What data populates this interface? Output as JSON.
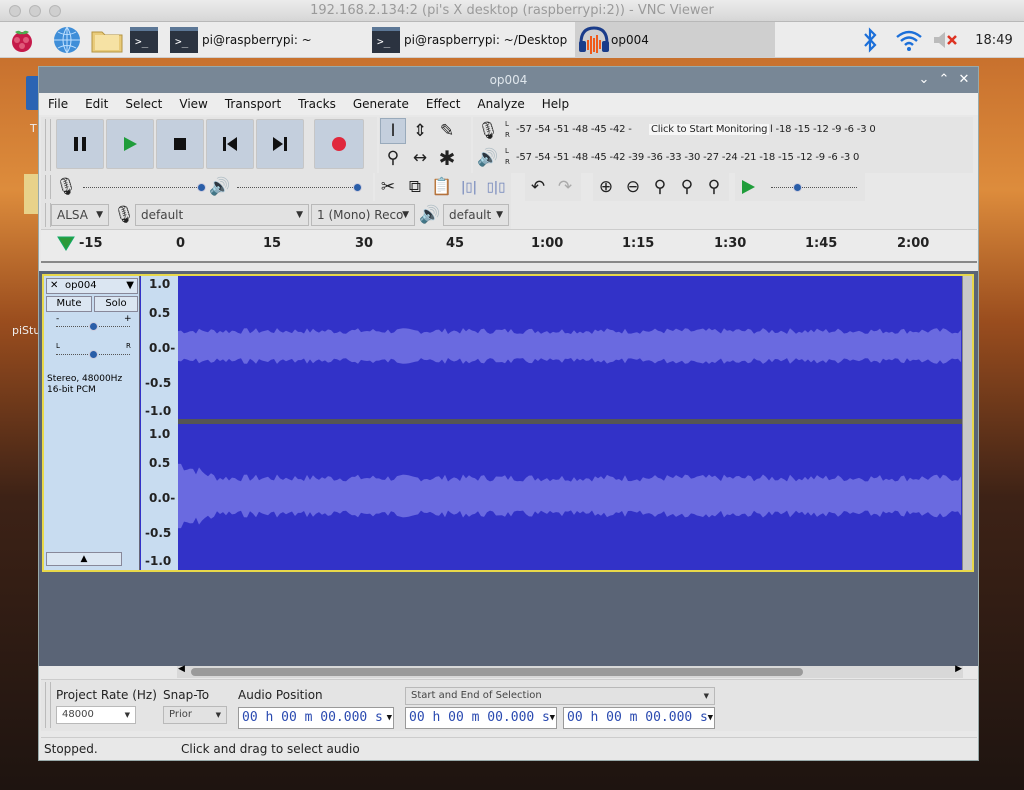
{
  "vnc": {
    "title": "192.168.2.134:2 (pi's X desktop (raspberrypi:2)) - VNC Viewer"
  },
  "taskbar": {
    "tasks": [
      "pi@raspberrypi: ~",
      "pi@raspberrypi: ~/Desktop",
      "op004"
    ],
    "time": "18:49"
  },
  "desktop": {
    "labels": [
      "T",
      "piStu"
    ]
  },
  "window": {
    "title": "op004"
  },
  "menu": [
    "File",
    "Edit",
    "Select",
    "View",
    "Transport",
    "Tracks",
    "Generate",
    "Effect",
    "Analyze",
    "Help"
  ],
  "meters": {
    "record_scale": "-57 -54 -51 -48 -45 -42 -",
    "monitor_hint": "Click to Start Monitoring",
    "record_scale_right": "l -18 -15 -12  -9  -6  -3  0",
    "play_scale": "-57 -54 -51 -48 -45 -42 -39 -36 -33 -30 -27 -24 -21 -18 -15 -12  -9  -6  -3  0",
    "l": "L",
    "r": "R"
  },
  "device": {
    "host": "ALSA",
    "rec_device": "default",
    "channels": "1 (Mono) Reco",
    "play_device": "default"
  },
  "ruler": [
    "-15",
    "0",
    "15",
    "30",
    "45",
    "1:00",
    "1:15",
    "1:30",
    "1:45",
    "2:00"
  ],
  "track": {
    "name": "op004",
    "mute": "Mute",
    "solo": "Solo",
    "minus": "-",
    "plus": "+",
    "left": "L",
    "right": "R",
    "info1": "Stereo, 48000Hz",
    "info2": "16-bit PCM",
    "scale": [
      "1.0",
      "0.5",
      "0.0-",
      "-0.5",
      "-1.0"
    ]
  },
  "selbar": {
    "rate_label": "Project Rate (Hz)",
    "rate": "48000",
    "snap_label": "Snap-To",
    "snap": "Prior",
    "pos_label": "Audio Position",
    "pos": "00 h 00 m 00.000 s",
    "sel_mode": "Start and End of Selection",
    "sel_start": "00 h 00 m 00.000 s",
    "sel_end": "00 h 00 m 00.000 s"
  },
  "status": {
    "state": "Stopped.",
    "hint": "Click and drag to select audio"
  },
  "colors": {
    "wave_bg": "#3232c8",
    "wave_fg": "#6464dc",
    "track_panel": "#c8dcf0",
    "empty_area": "#5a6476",
    "titlebar": "#788796"
  }
}
